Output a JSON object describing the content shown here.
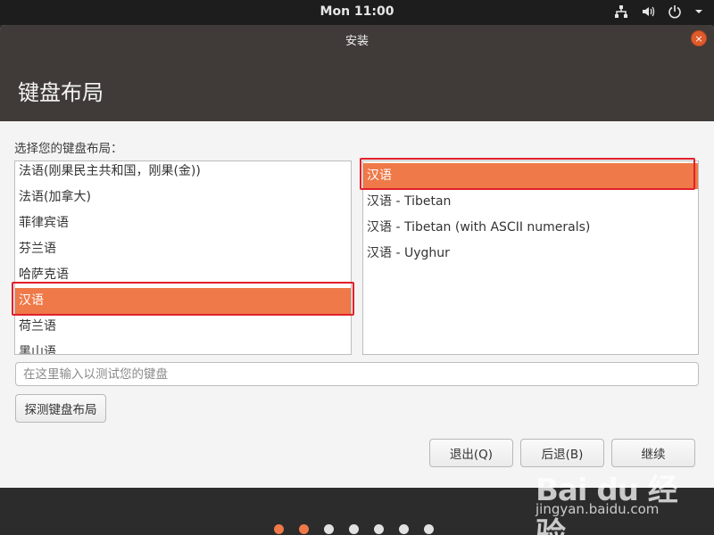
{
  "top_panel": {
    "clock": "Mon 11:00",
    "icons": [
      "network-icon",
      "volume-icon",
      "power-icon",
      "chevron-down-icon"
    ]
  },
  "window": {
    "title": "安装",
    "close_icon": "×"
  },
  "page": {
    "heading": "键盘布局",
    "prompt": "选择您的键盘布局："
  },
  "layouts": [
    {
      "label": "法语(刚果民主共和国，刚果(金))"
    },
    {
      "label": "法语(加拿大)"
    },
    {
      "label": "菲律宾语"
    },
    {
      "label": "芬兰语"
    },
    {
      "label": "哈萨克语"
    },
    {
      "label": "汉语",
      "selected": true
    },
    {
      "label": "荷兰语"
    },
    {
      "label": "黑山语"
    }
  ],
  "variants": [
    {
      "label": "汉语",
      "selected": true
    },
    {
      "label": "汉语 - Tibetan"
    },
    {
      "label": "汉语 - Tibetan (with ASCII numerals)"
    },
    {
      "label": "汉语 - Uyghur"
    }
  ],
  "test_input": {
    "value": "",
    "placeholder": "在这里输入以测试您的键盘"
  },
  "buttons": {
    "detect": "探测键盘布局",
    "quit": "退出(Q)",
    "back": "后退(B)",
    "continue": "继续"
  },
  "progress": {
    "total_steps": 7,
    "completed_steps": 2
  },
  "watermark": {
    "logo": "Bai du 经验",
    "url": "jingyan.baidu.com"
  },
  "colors": {
    "accent": "#ef7948",
    "header": "#403b39",
    "annotation": "#e0202a"
  }
}
